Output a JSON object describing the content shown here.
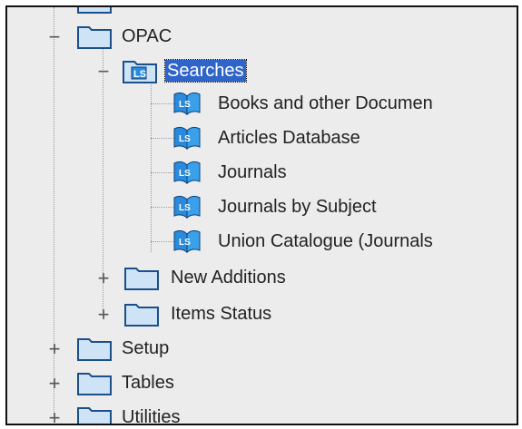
{
  "tree": {
    "opac": {
      "toggle": "−",
      "label": "OPAC",
      "searches": {
        "toggle": "−",
        "label": "Searches",
        "items": [
          "Books and other Documen",
          "Articles Database",
          "Journals",
          "Journals by Subject",
          "Union Catalogue (Journals"
        ]
      },
      "new_additions": {
        "toggle": "+",
        "label": "New Additions"
      },
      "items_status": {
        "toggle": "+",
        "label": "Items Status"
      }
    },
    "setup": {
      "toggle": "+",
      "label": "Setup"
    },
    "tables": {
      "toggle": "+",
      "label": "Tables"
    },
    "utilities": {
      "toggle": "+",
      "label": "Utilities"
    }
  },
  "colors": {
    "background": "#ececec",
    "selection": "#2f64c9",
    "folder_fill": "#cfe3f7",
    "book_blue": "#2a8bdc"
  },
  "icons": {
    "folder": "folder-icon",
    "search_book": "book-search-icon"
  }
}
